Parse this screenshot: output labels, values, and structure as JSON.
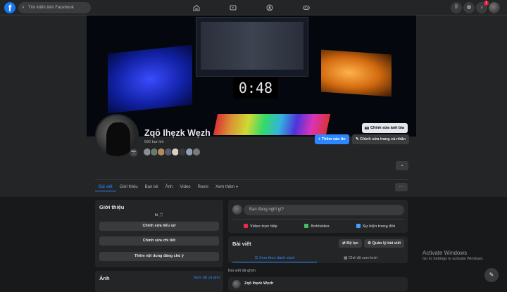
{
  "topbar": {
    "logo_letter": "f",
    "search_placeholder": "Tìm kiếm trên Facebook",
    "notifications_badge": "1"
  },
  "profile": {
    "name": "Zqô Ihẹzk Wẹzh",
    "friends_count": "690 bạn bè",
    "cover_edit_label": "Chỉnh sửa ảnh bìa",
    "cover_clock_text": "0:48",
    "add_story_label": "+ Thêm vào tin",
    "edit_profile_label": "✎ Chỉnh sửa trang cá nhân",
    "friend_avatar_colors": [
      "#8a8d91",
      "#6a7a6a",
      "#b78a5a",
      "#5a5a6a",
      "#d9d0c0",
      "#3a3a3a",
      "#8fa0b5",
      "#7a7a7a"
    ]
  },
  "tabs": {
    "items": [
      "Bài viết",
      "Giới thiệu",
      "Bạn bè",
      "Ảnh",
      "Video",
      "Reels",
      "Xem thêm ▾"
    ],
    "active_index": 0
  },
  "intro": {
    "title": "Giới thiệu",
    "bio": "hi 🎵",
    "edit_bio_label": "Chỉnh sửa tiểu sử",
    "edit_details_label": "Chỉnh sửa chi tiết",
    "add_featured_label": "Thêm nội dung đáng chú ý"
  },
  "photos": {
    "title": "Ảnh",
    "see_all_label": "Xem tất cả ảnh"
  },
  "composer": {
    "placeholder": "Bạn đang nghĩ gì?",
    "live_video_label": "Video trực tiếp",
    "photo_video_label": "Ảnh/video",
    "life_event_label": "Sự kiện trong đời"
  },
  "posts": {
    "title": "Bài viết",
    "filter_label": "⇄ Bộ lọc",
    "manage_label": "⚙ Quản lý bài viết",
    "list_view_label": "☰ Xem theo danh sách",
    "grid_view_label": "▦ Chế độ xem lưới",
    "pinned_label": "Bài viết đã ghim",
    "first_post_author": "Zqô Ihẹzk Wẹzh"
  },
  "watermark": {
    "title": "Activate Windows",
    "subtitle": "Go to Settings to activate Windows."
  },
  "colors": {
    "accent": "#2d88ff",
    "background": "#18191a",
    "surface": "#242526",
    "button": "#3a3b3c"
  }
}
